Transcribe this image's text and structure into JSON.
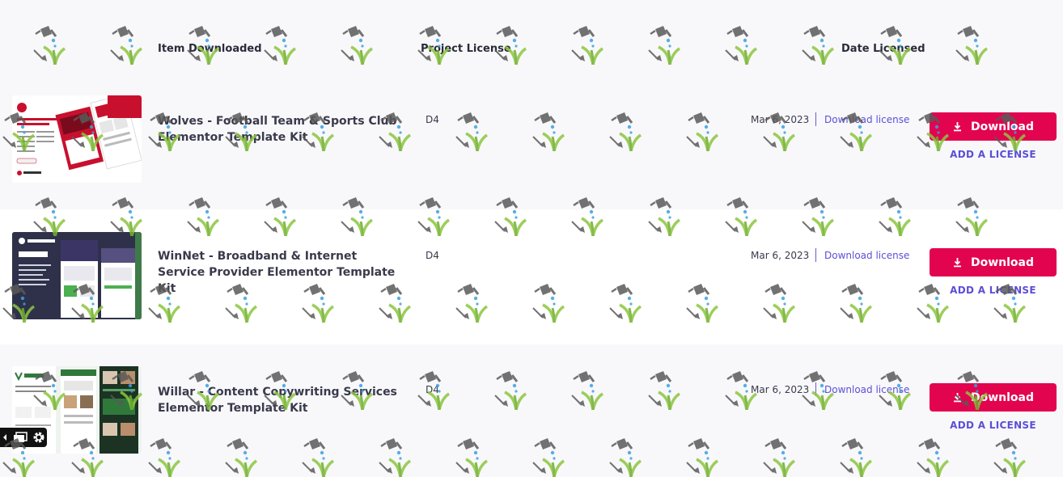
{
  "columns": {
    "item": "Item Downloaded",
    "project_license": "Project License",
    "date_licensed": "Date Licensed"
  },
  "rows": [
    {
      "title": "Wolves - Football Team & Sports Club Elementor Template Kit",
      "license": "D4",
      "date": "Mar 6, 2023",
      "download_license": "Download license",
      "download": "Download",
      "add_license": "ADD A LICENSE",
      "thumb_heading": "FOOTBALL TEAM & SPORTS CLUB",
      "thumb_sub": "ELEMENTOR TEMPLATE KIT",
      "thumb_brand": "elementor",
      "accent": "#c8102e"
    },
    {
      "title": "WinNet - Broadband & Internet Service Provider Elementor Template Kit",
      "license": "D4",
      "date": "Mar 6, 2023",
      "download_license": "Download license",
      "download": "Download",
      "add_license": "ADD A LICENSE",
      "thumb_heading": "winnet",
      "thumb_brand": "elementor",
      "accent": "#3b3566"
    },
    {
      "title": "Willar - Content Copywriting Services Elementor Template Kit",
      "license": "D4",
      "date": "Mar 6, 2023",
      "download_license": "Download license",
      "download": "Download",
      "add_license": "ADD A LICENSE",
      "thumb_heading": "WILLAR",
      "accent": "#2f7a3b"
    }
  ],
  "colors": {
    "primary_button": "#e2044f",
    "link": "#5b4fd6",
    "header_bg": "#f8f8fb"
  },
  "icons": {
    "download": "download-icon",
    "watermark": "watering-can-plant-icon",
    "settings": "gear-icon",
    "window": "window-icon"
  }
}
